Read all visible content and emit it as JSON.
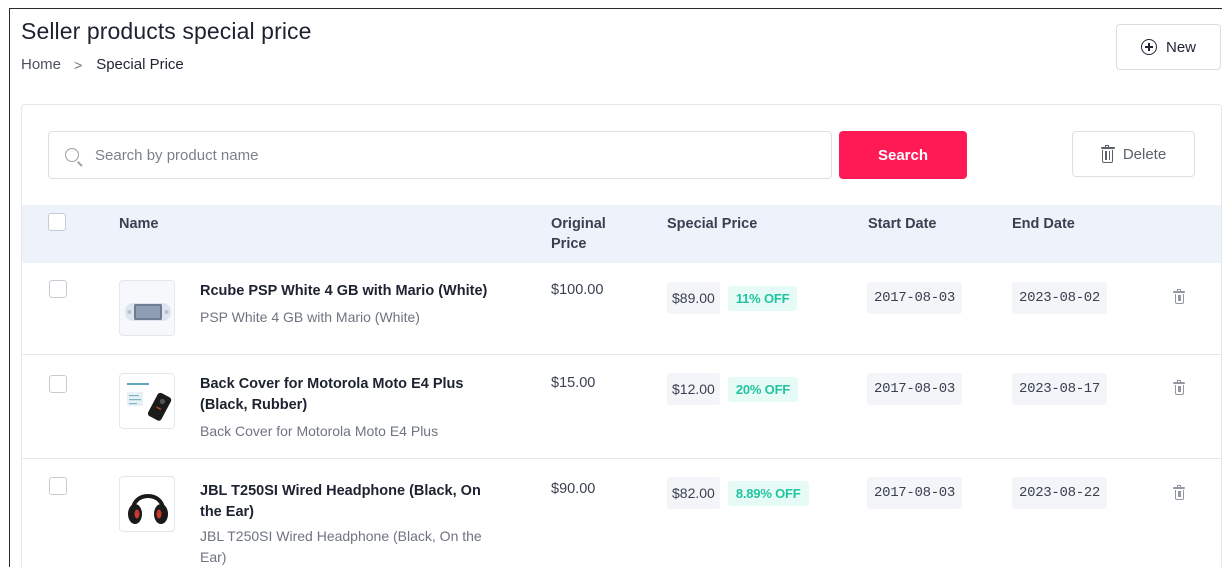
{
  "header": {
    "title": "Seller products special price",
    "breadcrumb": {
      "home": "Home",
      "separator": ">",
      "current": "Special Price"
    },
    "new_button": {
      "label": "New",
      "icon": "plus-circle-icon"
    }
  },
  "toolbar": {
    "search_placeholder": "Search by product name",
    "search_value": "",
    "search_button": "Search",
    "delete_button": "Delete"
  },
  "table": {
    "columns": {
      "name": "Name",
      "original_price_line1": "Original",
      "original_price_line2": "Price",
      "special_price": "Special Price",
      "start_date": "Start Date",
      "end_date": "End Date"
    },
    "rows": [
      {
        "name": "Rcube PSP White 4 GB with Mario (White)",
        "subtitle": "PSP White 4 GB with Mario (White)",
        "original_price": "$100.00",
        "special_price": "$89.00",
        "discount": "11% OFF",
        "start_date": "2017-08-03",
        "end_date": "2023-08-02"
      },
      {
        "name": "Back Cover for Motorola Moto E4 Plus (Black, Rubber)",
        "subtitle": "Back Cover for Motorola Moto E4 Plus",
        "original_price": "$15.00",
        "special_price": "$12.00",
        "discount": "20% OFF",
        "start_date": "2017-08-03",
        "end_date": "2023-08-17"
      },
      {
        "name": "JBL T250SI Wired Headphone (Black, On the Ear)",
        "subtitle": "JBL T250SI Wired Headphone (Black, On the Ear)",
        "original_price": "$90.00",
        "special_price": "$82.00",
        "discount": "8.89% OFF",
        "start_date": "2017-08-03",
        "end_date": "2023-08-22"
      }
    ]
  },
  "colors": {
    "accent": "#ff1a55",
    "header_bg": "#edf2fb",
    "discount_text": "#21c4a0",
    "discount_bg": "#e6fbf6"
  }
}
